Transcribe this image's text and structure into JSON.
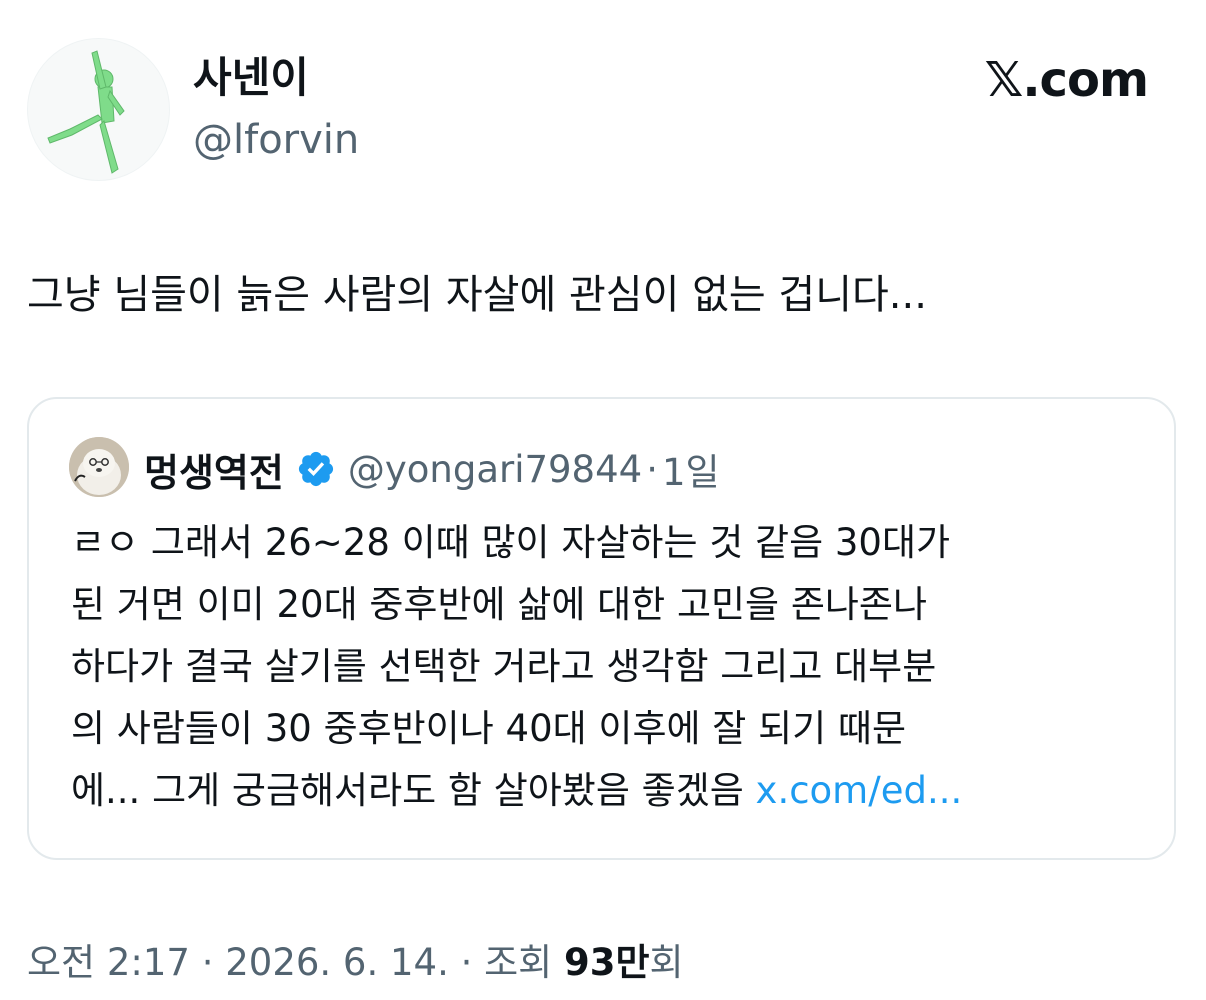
{
  "author": {
    "name": "사넨이",
    "handle": "@lforvin"
  },
  "brand": {
    "logo_text": "𝕏.com"
  },
  "tweet": {
    "text": "그냥 님들이 늙은 사람의 자살에 관심이 없는 겁니다..."
  },
  "quote": {
    "name": "멍생역전",
    "handle": "@yongari79844",
    "separator": "·",
    "time": "1일",
    "lines": [
      "ㄹㅇ 그래서 26~28 이때 많이 자살하는 것 같음 30대가",
      "된 거면 이미 20대 중후반에 삶에 대한 고민을 존나존나",
      "하다가 결국 살기를 선택한 거라고 생각함 그리고 대부분",
      "의 사람들이 30 중후반이나 40대 이후에 잘 되기 때문",
      "에... 그게 궁금해서라도 함 살아봤음 좋겠음"
    ],
    "link": "x.com/ed..."
  },
  "meta": {
    "time": "오전 2:17",
    "sep1": "·",
    "date": "2026. 6. 14.",
    "sep2": "·",
    "views_label": "조회",
    "views_count": "93만",
    "views_unit": "회"
  },
  "colors": {
    "text": "#0f1419",
    "secondary": "#536471",
    "link": "#1d9bf0",
    "verified": "#1d9bf0",
    "card_border": "#e3e9ec"
  },
  "icons": {
    "verified": "verified-badge-icon",
    "author_avatar": "green-figure-avatar",
    "quote_avatar": "dog-avatar"
  }
}
